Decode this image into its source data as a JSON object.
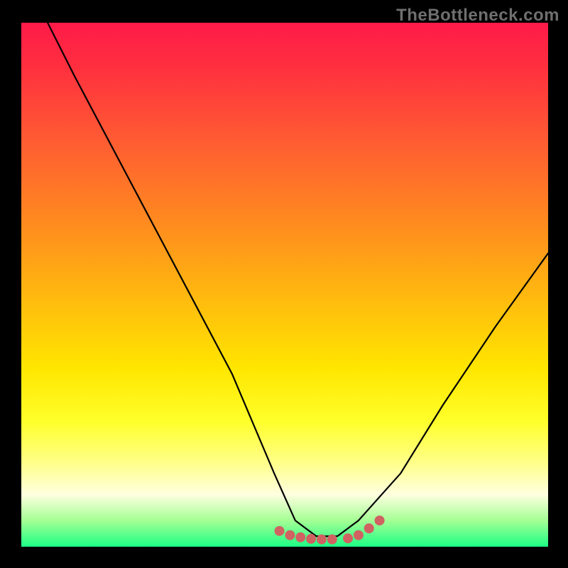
{
  "brand": "TheBottleneck.com",
  "chart_data": {
    "type": "line",
    "title": "",
    "xlabel": "",
    "ylabel": "",
    "xlim": [
      0,
      100
    ],
    "ylim": [
      0,
      100
    ],
    "grid": false,
    "legend": false,
    "series": [
      {
        "name": "black-curve",
        "color": "#000000",
        "x": [
          5,
          10,
          20,
          30,
          40,
          48,
          52,
          56,
          60,
          64,
          72,
          80,
          90,
          100
        ],
        "y": [
          100,
          90,
          71,
          52,
          33,
          14,
          5,
          2,
          2,
          5,
          14,
          27,
          42,
          56
        ]
      },
      {
        "name": "bottom-dots",
        "color": "#d06262",
        "x": [
          49,
          51,
          53,
          55,
          57,
          59,
          62,
          64,
          66,
          68
        ],
        "y": [
          3,
          2.2,
          1.8,
          1.5,
          1.4,
          1.4,
          1.6,
          2.2,
          3.5,
          5
        ]
      }
    ],
    "gradient_stops": [
      {
        "offset": 0.0,
        "color": "#ff1a49"
      },
      {
        "offset": 0.08,
        "color": "#ff2e3f"
      },
      {
        "offset": 0.22,
        "color": "#ff5a33"
      },
      {
        "offset": 0.38,
        "color": "#ff8a1f"
      },
      {
        "offset": 0.52,
        "color": "#ffb80f"
      },
      {
        "offset": 0.66,
        "color": "#ffe600"
      },
      {
        "offset": 0.76,
        "color": "#ffff2a"
      },
      {
        "offset": 0.84,
        "color": "#ffff8a"
      },
      {
        "offset": 0.9,
        "color": "#ffffe0"
      },
      {
        "offset": 0.95,
        "color": "#a4ff95"
      },
      {
        "offset": 1.0,
        "color": "#1dff85"
      }
    ]
  }
}
